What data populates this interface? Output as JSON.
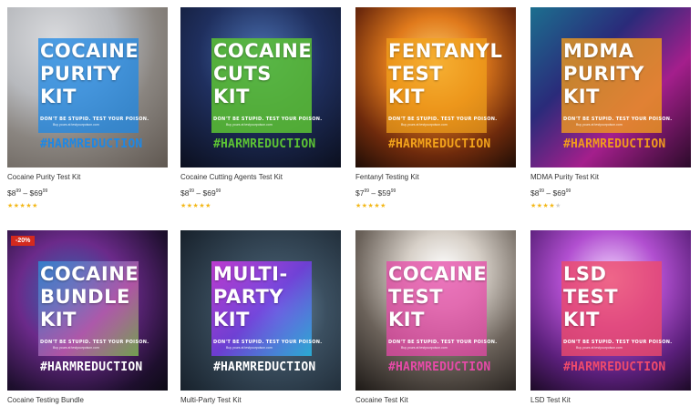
{
  "products": [
    {
      "title": "Cocaine Purity Test Kit",
      "image_text": "COCAINE\nPURITY\nKIT",
      "tagline": "DON'T BE STUPID. TEST YOUR POISON.",
      "subline": "Buy yours at testyourpoison.com",
      "hashtag": "#HARMREDUCTION",
      "price_low_main": "8",
      "price_low_cents": "99",
      "price_high_main": "69",
      "price_high_cents": "99",
      "rating": 4.5,
      "overlay_color": "#1e88e5",
      "hashtag_color": "#1e88e5"
    },
    {
      "title": "Cocaine Cutting Agents Test Kit",
      "image_text": "COCAINE\nCUTS\nKIT",
      "tagline": "DON'T BE STUPID. TEST YOUR POISON.",
      "subline": "Buy yours at testyourpoison.com",
      "hashtag": "#HARMREDUCTION",
      "price_low_main": "8",
      "price_low_cents": "99",
      "price_high_main": "69",
      "price_high_cents": "99",
      "rating": 4.5,
      "overlay_color": "#5cc334",
      "hashtag_color": "#5cc334"
    },
    {
      "title": "Fentanyl Testing Kit",
      "image_text": "FENTANYL\nTEST\nKIT",
      "tagline": "DON'T BE STUPID. TEST YOUR POISON.",
      "subline": "Buy yours at testyourpoison.com",
      "hashtag": "#HARMREDUCTION",
      "price_low_main": "7",
      "price_low_cents": "99",
      "price_high_main": "59",
      "price_high_cents": "99",
      "rating": 4.5,
      "overlay_color": "#f2a21b",
      "hashtag_color": "#f2a21b"
    },
    {
      "title": "MDMA Purity Test Kit",
      "image_text": "MDMA\nPURITY\nKIT",
      "tagline": "DON'T BE STUPID. TEST YOUR POISON.",
      "subline": "Buy yours at testyourpoison.com",
      "hashtag": "#HARMREDUCTION",
      "price_low_main": "8",
      "price_low_cents": "99",
      "price_high_main": "69",
      "price_high_cents": "99",
      "rating": 4,
      "overlay_color": "#f09a1e",
      "hashtag_color": "#f09a1e"
    },
    {
      "title": "Cocaine Testing Bundle",
      "badge": "-20%",
      "image_text": "COCAINE\nBUNDLE\nKIT",
      "tagline": "DON'T BE STUPID. TEST YOUR POISON.",
      "subline": "Buy yours at testyourpoison.com",
      "hashtag": "#HARMREDUCTION",
      "overlay_color": "#3aa3d8",
      "hashtag_color": "#ffffff"
    },
    {
      "title": "Multi-Party Test Kit",
      "image_text": "MULTI-\nPARTY\nKIT",
      "tagline": "DON'T BE STUPID. TEST YOUR POISON.",
      "subline": "Buy yours at testyourpoison.com",
      "hashtag": "#HARMREDUCTION",
      "overlay_color": "#b43cf0",
      "hashtag_color": "#ffffff"
    },
    {
      "title": "Cocaine Test Kit",
      "image_text": "COCAINE\nTEST\nKIT",
      "tagline": "DON'T BE STUPID. TEST YOUR POISON.",
      "subline": "Buy yours at testyourpoison.com",
      "hashtag": "#HARMREDUCTION",
      "overlay_color": "#e64aa8",
      "hashtag_color": "#e64aa8"
    },
    {
      "title": "LSD Test Kit",
      "image_text": "LSD\nTEST\nKIT",
      "tagline": "DON'T BE STUPID. TEST YOUR POISON.",
      "subline": "Buy yours at testyourpoison.com",
      "hashtag": "#HARMREDUCTION",
      "overlay_color": "#ee4a6c",
      "hashtag_color": "#ee4a6c"
    }
  ]
}
